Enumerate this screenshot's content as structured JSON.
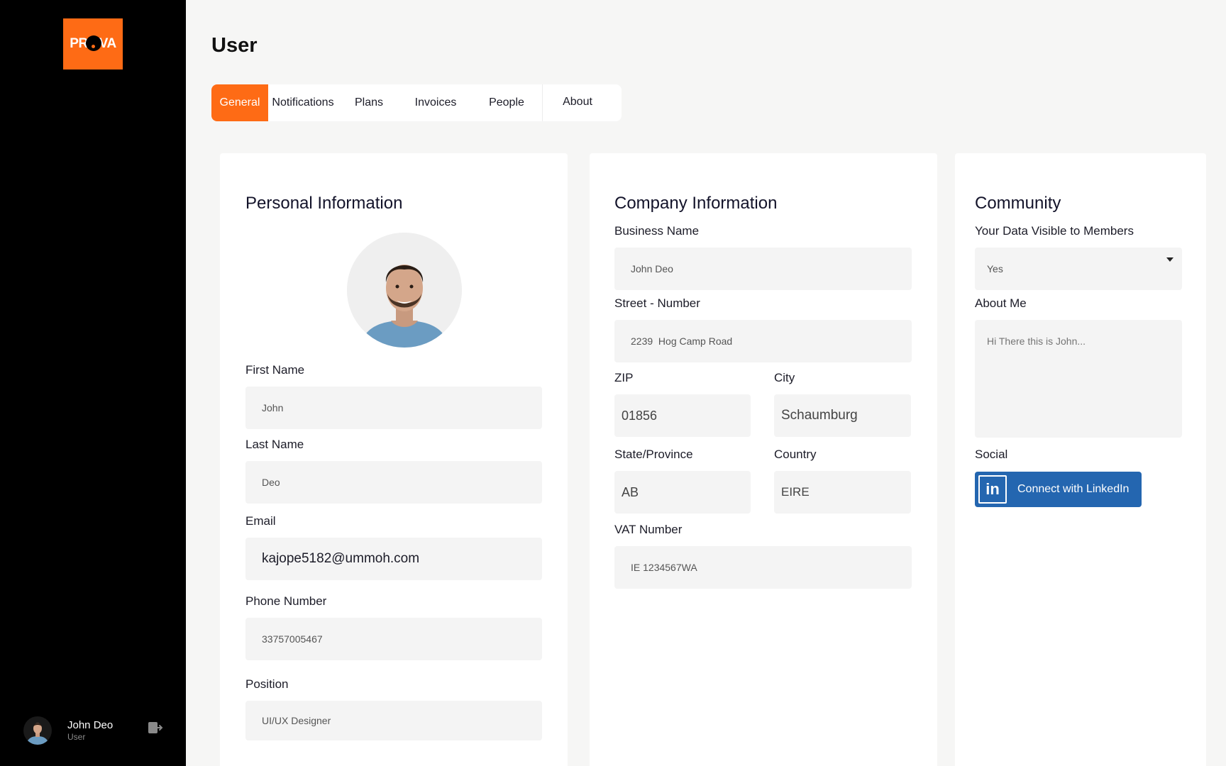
{
  "brand": {
    "logo_text_left": "PR",
    "logo_text_right": "VA",
    "accent": "#fe6b15",
    "linkedin_color": "#2466b0"
  },
  "sidebar": {
    "user": {
      "name": "John Deo",
      "role": "User"
    },
    "logout_icon": "logout-icon"
  },
  "page": {
    "title": "User"
  },
  "tabs": [
    {
      "label": "General",
      "active": true
    },
    {
      "label": "Notifications"
    },
    {
      "label": "Plans"
    },
    {
      "label": "Invoices"
    },
    {
      "label": "People"
    },
    {
      "label": "About"
    }
  ],
  "personal": {
    "title": "Personal Information",
    "first_name": {
      "label": "First Name",
      "value": "John"
    },
    "last_name": {
      "label": "Last Name",
      "value": "Deo"
    },
    "email": {
      "label": "Email",
      "value": "kajope5182@ummoh.com"
    },
    "phone": {
      "label": "Phone Number",
      "value": "33757005467"
    },
    "position": {
      "label": "Position",
      "value": "UI/UX Designer"
    }
  },
  "company": {
    "title": "Company Information",
    "business_name": {
      "label": "Business Name",
      "value": "John Deo"
    },
    "street": {
      "label": "Street - Number",
      "value": "2239  Hog Camp Road"
    },
    "zip": {
      "label": "ZIP",
      "value": "01856"
    },
    "city": {
      "label": "City",
      "value": "Schaumburg"
    },
    "state": {
      "label": "State/Province",
      "value": "AB"
    },
    "country": {
      "label": "Country",
      "value": "EIRE"
    },
    "vat": {
      "label": "VAT Number",
      "value": "IE 1234567WA"
    }
  },
  "community": {
    "title": "Community",
    "visible": {
      "label": "Your Data Visible to Members",
      "value": "Yes"
    },
    "about": {
      "label": "About Me",
      "placeholder": "Hi There this is John..."
    },
    "social": {
      "label": "Social",
      "button": "Connect with LinkedIn",
      "icon": "linkedin-icon"
    }
  }
}
